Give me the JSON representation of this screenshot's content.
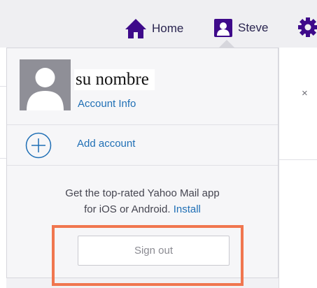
{
  "header": {
    "home_label": "Home",
    "user_label": "Steve",
    "icons": {
      "home": "home-icon",
      "user": "user-icon",
      "settings": "gear-icon"
    },
    "accent_color": "#400090"
  },
  "panel": {
    "account_name": "su nombre",
    "account_info_link": "Account Info",
    "add_account_label": "Add account",
    "promo_line1": "Get the top-rated Yahoo Mail app",
    "promo_line2": "for iOS or Android.",
    "install_link": "Install",
    "sign_out_label": "Sign out"
  },
  "background": {
    "close_glyph": "×"
  },
  "colors": {
    "link": "#1f6fb5",
    "highlight": "#f0764f"
  }
}
